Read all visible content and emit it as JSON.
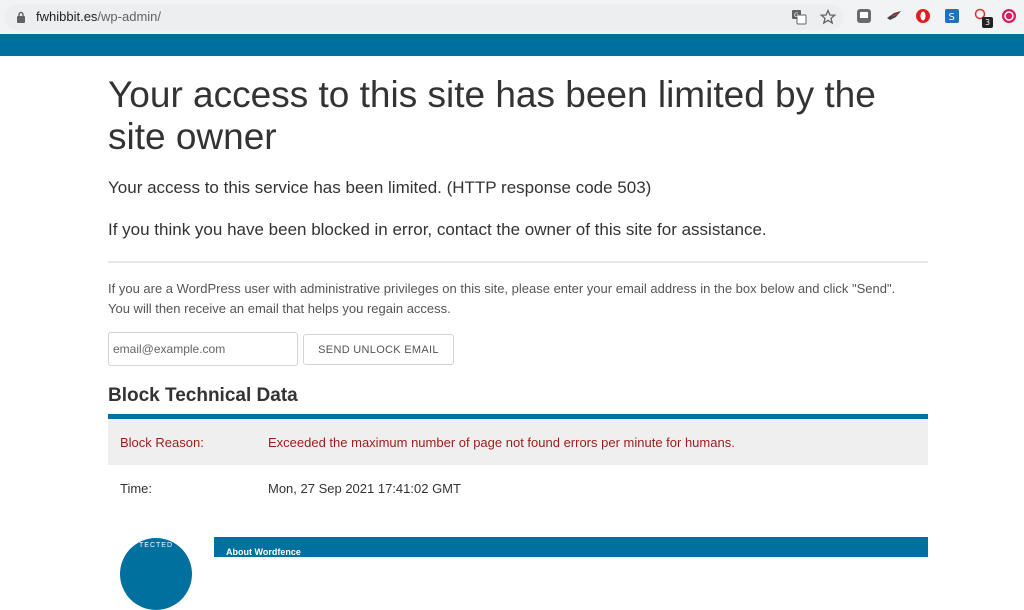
{
  "browser": {
    "url_host": "fwhibbit.es",
    "url_path": "/wp-admin/",
    "icons": [
      "lock-icon",
      "translate-icon",
      "star-icon"
    ],
    "extensions": [
      "ext-gray-icon",
      "ext-bird-icon",
      "ext-red-icon",
      "ext-blue-icon",
      "ext-badge-icon",
      "ext-pink-icon"
    ],
    "extension_badge": "3",
    "accent": "#00709e"
  },
  "page": {
    "title": "Your access to this site has been limited by the site owner",
    "message": "Your access to this service has been limited. (HTTP response code 503)",
    "contact": "If you think you have been blocked in error, contact the owner of this site for assistance.",
    "wp_notice": "If you are a WordPress user with administrative privileges on this site, please enter your email address in the box below and click \"Send\". You will then receive an email that helps you regain access.",
    "email_placeholder": "email@example.com",
    "send_button": "SEND UNLOCK EMAIL",
    "section_title": "Block Technical Data",
    "reason_label": "Block Reason:",
    "reason_value": "Exceeded the maximum number of page not found errors per minute for humans.",
    "time_label": "Time:",
    "time_value": "Mon, 27 Sep 2021 17:41:02 GMT",
    "badge_text": "TECTED",
    "about_title": "About Wordfence",
    "reason_color": "#9a1c1c"
  }
}
